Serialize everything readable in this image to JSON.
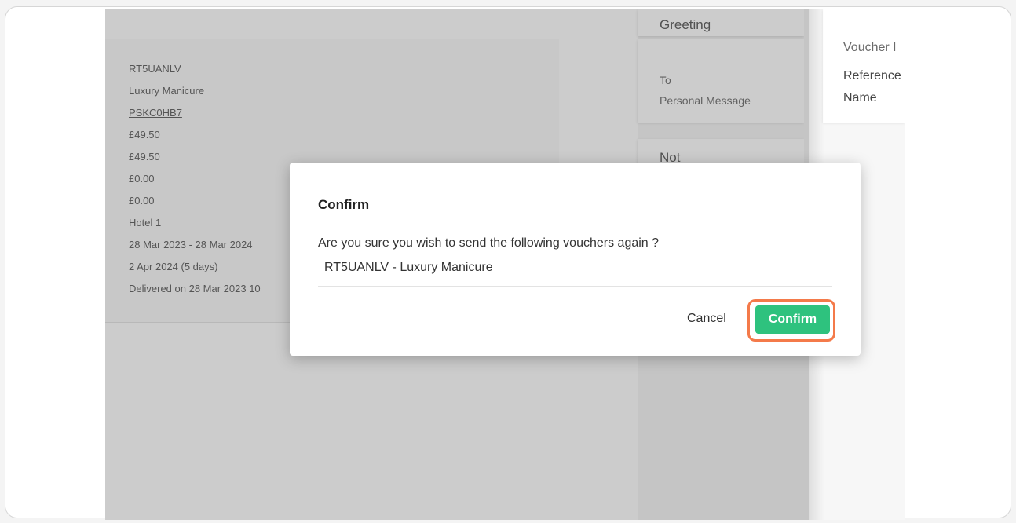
{
  "voucher_details": [
    "RT5UANLV",
    "Luxury Manicure",
    "PSKC0HB7",
    "£49.50",
    "£49.50",
    "£0.00",
    "£0.00",
    "Hotel 1",
    "28 Mar 2023 - 28 Mar 2024",
    "2 Apr 2024 (5 days)",
    "Delivered on 28 Mar 2023 10"
  ],
  "greeting_card": {
    "title": "Greeting",
    "to_label": "To",
    "personal_message_label": "Personal Message"
  },
  "notes_card": {
    "title": "Not"
  },
  "right_panel": {
    "voucher_info": "Voucher I",
    "reference": "Reference",
    "name": "Name"
  },
  "modal": {
    "title": "Confirm",
    "message": "Are you sure you wish to send the following vouchers again ?",
    "item": "RT5UANLV - Luxury Manicure",
    "cancel_label": "Cancel",
    "confirm_label": "Confirm"
  },
  "colors": {
    "confirm_button": "#2ec27e",
    "highlight_ring": "#f47a4a"
  }
}
